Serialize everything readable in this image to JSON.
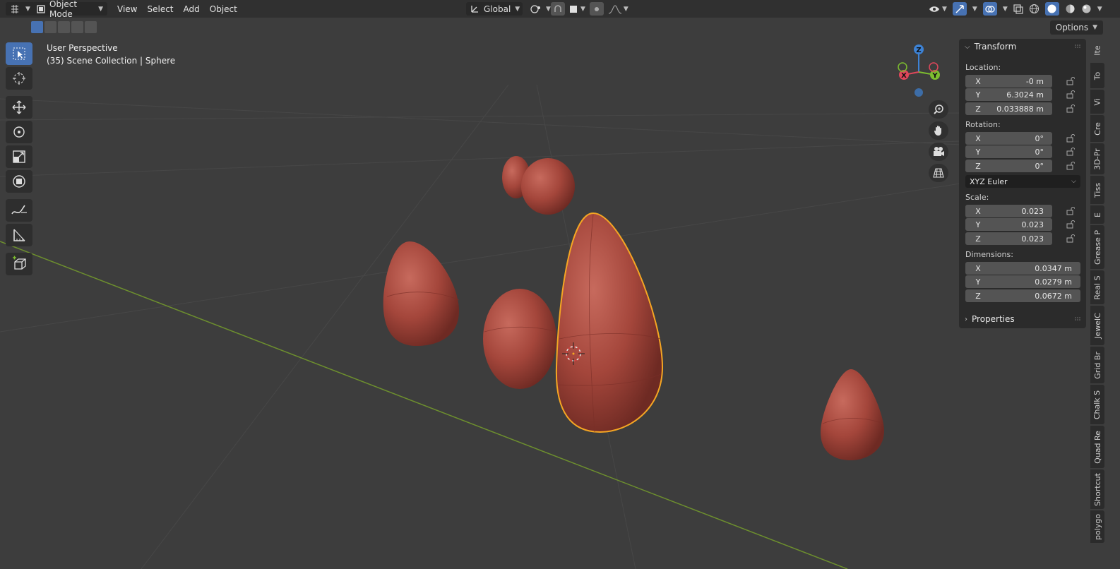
{
  "header": {
    "editor_type_icon": "cursor-grid-icon",
    "mode": "Object Mode",
    "menus": [
      "View",
      "Select",
      "Add",
      "Object"
    ],
    "transform_orientation": "Global",
    "options_label": "Options"
  },
  "viewport": {
    "perspective": "User Perspective",
    "collection": "(35) Scene Collection | Sphere"
  },
  "gizmo": {
    "x": "X",
    "y": "Y",
    "z": "Z",
    "colors": {
      "x": "#e0475b",
      "y": "#7dbd2f",
      "z": "#3d82d4"
    }
  },
  "toolbar": {
    "tools": [
      "select-box-icon",
      "cursor-icon",
      "move-icon",
      "rotate-icon",
      "scale-icon",
      "transform-icon",
      "annotate-icon",
      "measure-icon",
      "add-cube-icon"
    ]
  },
  "npanel": {
    "title": "Transform",
    "location_label": "Location:",
    "location": [
      {
        "axis": "X",
        "value": "-0 m"
      },
      {
        "axis": "Y",
        "value": "6.3024 m"
      },
      {
        "axis": "Z",
        "value": "0.033888 m"
      }
    ],
    "rotation_label": "Rotation:",
    "rotation": [
      {
        "axis": "X",
        "value": "0°"
      },
      {
        "axis": "Y",
        "value": "0°"
      },
      {
        "axis": "Z",
        "value": "0°"
      }
    ],
    "rotation_mode": "XYZ Euler",
    "scale_label": "Scale:",
    "scale": [
      {
        "axis": "X",
        "value": "0.023"
      },
      {
        "axis": "Y",
        "value": "0.023"
      },
      {
        "axis": "Z",
        "value": "0.023"
      }
    ],
    "dimensions_label": "Dimensions:",
    "dimensions": [
      {
        "axis": "X",
        "value": "0.0347 m"
      },
      {
        "axis": "Y",
        "value": "0.0279 m"
      },
      {
        "axis": "Z",
        "value": "0.0672 m"
      }
    ],
    "properties_title": "Properties"
  },
  "tabs": [
    "Ite",
    "To",
    "Vi",
    "Cre",
    "3D-Pr",
    "Tiss",
    "E",
    "Grease P",
    "Real S",
    "JewelC",
    "Grid Br",
    "Chalk S",
    "Quad Re",
    "Shortcut",
    "polygo"
  ],
  "colors": {
    "accent": "#4772b3",
    "selection_outline": "#f5a623",
    "mesh": "#a5483d",
    "x_axis_line": "#6d8f2e"
  }
}
